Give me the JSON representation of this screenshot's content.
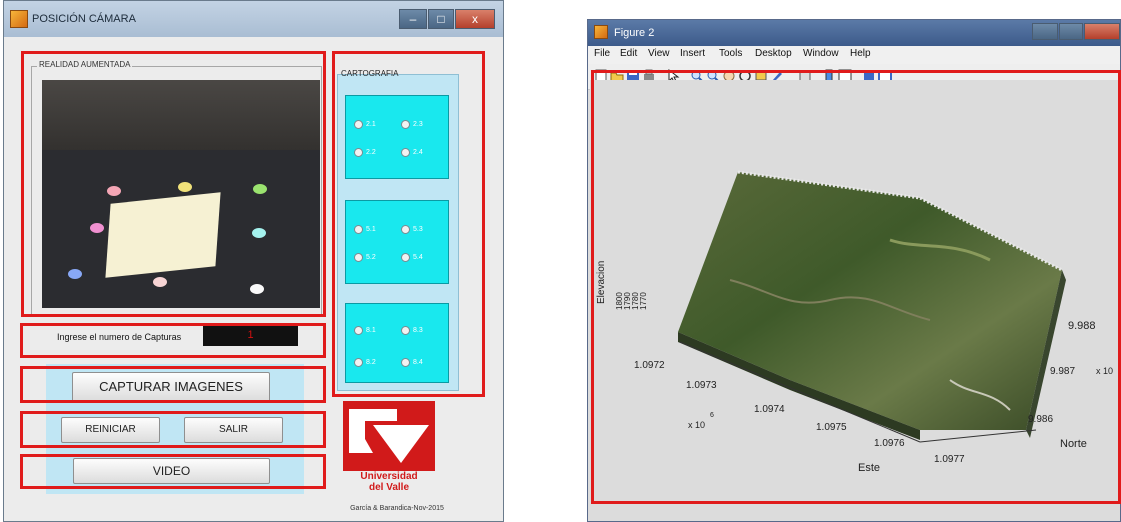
{
  "left_window": {
    "title": "POSICIÓN CÁMARA",
    "panel_label": "REALIDAD AUMENTADA",
    "captures_label": "Ingrese el numero de Capturas",
    "captures_value": "1",
    "buttons": {
      "capture": "CAPTURAR IMAGENES",
      "restart": "REINICIAR",
      "exit": "SALIR",
      "video": "VIDEO"
    },
    "cartography": {
      "label": "CARTOGRAFIA",
      "groups": [
        {
          "options": [
            "2.1",
            "2.3",
            "2.2",
            "2.4"
          ]
        },
        {
          "options": [
            "5.1",
            "5.3",
            "5.2",
            "5.4"
          ]
        },
        {
          "options": [
            "8.1",
            "8.3",
            "8.2",
            "8.4"
          ]
        }
      ]
    },
    "logo_text": "Universidad\ndel Valle",
    "credit": "García & Barandica-Nov-2015",
    "window_buttons": {
      "minimize": "–",
      "maximize": "□",
      "close": "x"
    }
  },
  "right_window": {
    "title": "Figure 2",
    "menu": [
      "File",
      "Edit",
      "View",
      "Insert",
      "Tools",
      "Desktop",
      "Window",
      "Help"
    ],
    "plot": {
      "z_label": "Elevacion",
      "z_ticks": [
        "1800",
        "1790",
        "1780",
        "1770"
      ],
      "x_label": "Este",
      "x_ticks": [
        "1.0972",
        "1.0973",
        "1.0974",
        "1.0975",
        "1.0976",
        "1.0977"
      ],
      "x_exponent": "x 10",
      "x_exponent_power": "6",
      "y_label": "Norte",
      "y_ticks": [
        "9.988",
        "9.987",
        "9.986"
      ],
      "y_exponent": "x 10"
    }
  },
  "colors": {
    "highlight": "#e01b1b",
    "cartography_box": "#19e8ee",
    "panel_blue": "#c0e6f4",
    "logo_red": "#d11a1a"
  }
}
